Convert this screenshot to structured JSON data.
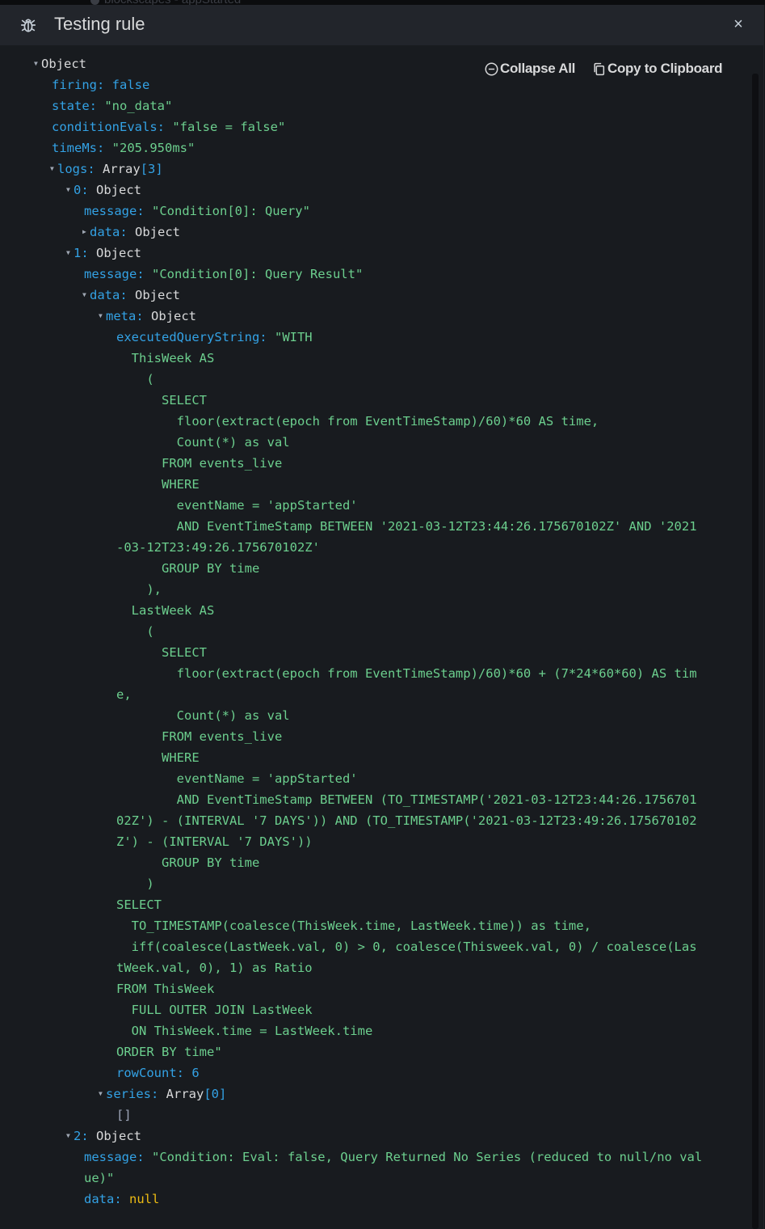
{
  "background": {
    "ghost_text": "blockscapes - appStarted"
  },
  "header": {
    "title": "Testing rule",
    "close_label": "×"
  },
  "actions": {
    "collapse_all": "Collapse All",
    "copy": "Copy to Clipboard"
  },
  "json": {
    "root_key": "Object",
    "firing_key": "firing:",
    "firing_val": "false",
    "state_key": "state:",
    "state_val": "\"no_data\"",
    "condition_key": "conditionEvals:",
    "condition_val": "\"false = false\"",
    "time_key": "timeMs:",
    "time_val": "\"205.950ms\"",
    "logs_key": "logs:",
    "logs_type": "Array",
    "logs_count": "[3]",
    "log0_key": "0:",
    "log0_type": "Object",
    "log0_message_key": "message:",
    "log0_message_val": "\"Condition[0]: Query\"",
    "log0_data_key": "data:",
    "log0_data_type": "Object",
    "log1_key": "1:",
    "log1_type": "Object",
    "log1_message_key": "message:",
    "log1_message_val": "\"Condition[0]: Query Result\"",
    "log1_data_key": "data:",
    "log1_data_type": "Object",
    "meta_key": "meta:",
    "meta_type": "Object",
    "query_key": "executedQueryString:",
    "query_lines": [
      "\"WITH",
      "  ThisWeek AS",
      "    (",
      "      SELECT",
      "        floor(extract(epoch from EventTimeStamp)/60)*60 AS time,",
      "        Count(*) as val",
      "      FROM events_live",
      "      WHERE",
      "        eventName = 'appStarted'",
      "        AND EventTimeStamp BETWEEN '2021-03-12T23:44:26.175670102Z' AND '2021",
      "-03-12T23:49:26.175670102Z'",
      "      GROUP BY time",
      "    ),",
      "  LastWeek AS",
      "    (",
      "      SELECT",
      "        floor(extract(epoch from EventTimeStamp)/60)*60 + (7*24*60*60) AS tim",
      "e,",
      "        Count(*) as val",
      "      FROM events_live",
      "      WHERE",
      "        eventName = 'appStarted'",
      "        AND EventTimeStamp BETWEEN (TO_TIMESTAMP('2021-03-12T23:44:26.1756701",
      "02Z') - (INTERVAL '7 DAYS')) AND (TO_TIMESTAMP('2021-03-12T23:49:26.175670102",
      "Z') - (INTERVAL '7 DAYS'))",
      "      GROUP BY time",
      "    )",
      "SELECT",
      "  TO_TIMESTAMP(coalesce(ThisWeek.time, LastWeek.time)) as time,",
      "  iff(coalesce(LastWeek.val, 0) > 0, coalesce(Thisweek.val, 0) / coalesce(Las",
      "tWeek.val, 0), 1) as Ratio",
      "FROM ThisWeek",
      "  FULL OUTER JOIN LastWeek",
      "  ON ThisWeek.time = LastWeek.time",
      "ORDER BY time\""
    ],
    "rowcount_key": "rowCount:",
    "rowcount_val": "6",
    "series_key": "series:",
    "series_type": "Array",
    "series_count": "[0]",
    "series_empty": "[]",
    "log2_key": "2:",
    "log2_type": "Object",
    "log2_message_key": "message:",
    "log2_message_val_1": "\"Condition: Eval: false, Query Returned No Series (reduced to null/no val",
    "log2_message_val_2": "ue)\"",
    "log2_data_key": "data:",
    "log2_data_val": "null"
  },
  "colors": {
    "key": "#33a2e5",
    "string": "#6ccf8e",
    "null": "#ecbb13",
    "text": "#d8d9da",
    "background": "#181b1f",
    "header": "#22252b"
  },
  "icons": {
    "header": "bug-icon",
    "collapse": "minus-circle-icon",
    "copy": "copy-icon",
    "close": "close-icon"
  }
}
